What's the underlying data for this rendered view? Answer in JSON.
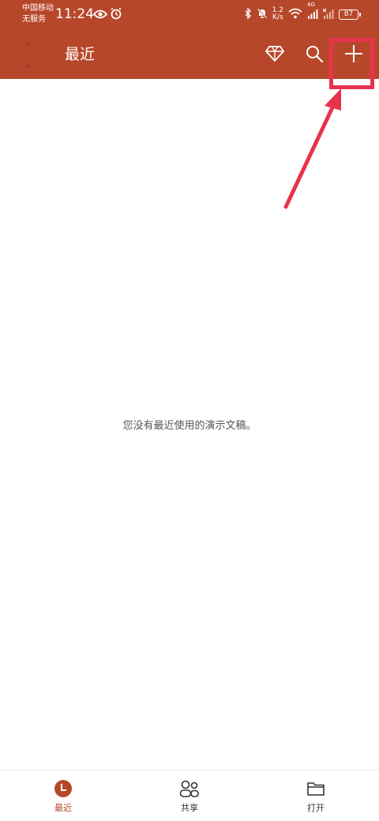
{
  "status_bar": {
    "carrier_line1": "中国移动",
    "carrier_line2": "无服务",
    "time": "11:24",
    "speed_value": "1.2",
    "speed_unit": "K/s",
    "network": "4G",
    "battery": "87"
  },
  "header": {
    "title": "最近",
    "icons": [
      "premium-diamond-icon",
      "search-icon",
      "plus-icon"
    ]
  },
  "main": {
    "empty_message": "您没有最近使用的演示文稿。"
  },
  "bottom_nav": {
    "items": [
      {
        "label": "最近",
        "icon": "clock-icon",
        "active": true
      },
      {
        "label": "共享",
        "icon": "people-icon",
        "active": false
      },
      {
        "label": "打开",
        "icon": "folder-icon",
        "active": false
      }
    ]
  },
  "colors": {
    "header_bg": "#b7472a",
    "annotation": "#e8334d",
    "active": "#b7472a"
  }
}
